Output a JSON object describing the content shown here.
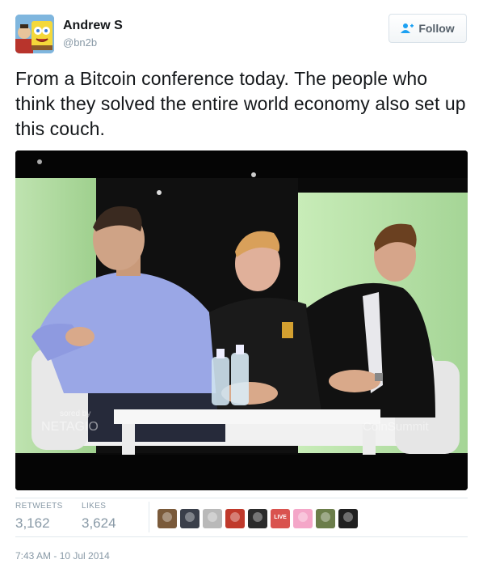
{
  "author": {
    "name": "Andrew S",
    "handle": "@bn2b",
    "avatar": "avatar-sponge-cartoon"
  },
  "follow_button": {
    "label": "Follow",
    "icon": "follow-user-plus-icon"
  },
  "tweet": {
    "text": "From a Bitcoin conference today. The people who think they solved the entire world economy also set up this couch."
  },
  "photo": {
    "description_icon": "conference-panel-photo",
    "sponsor_text": "sored by",
    "sponsor_brand": "NETAGIO",
    "watermark": "CoinSummit"
  },
  "stats": {
    "retweets_label": "RETWEETS",
    "retweets_value": "3,162",
    "likes_label": "LIKES",
    "likes_value": "3,624"
  },
  "likers": [
    {
      "name": "liker-avatar-1",
      "color": "#7a5a3a"
    },
    {
      "name": "liker-avatar-2",
      "color": "#3a3f4a"
    },
    {
      "name": "liker-avatar-3",
      "color": "#b9b9b9"
    },
    {
      "name": "liker-avatar-4",
      "color": "#c0392b"
    },
    {
      "name": "liker-avatar-5",
      "color": "#2b2b2b"
    },
    {
      "name": "liker-avatar-6",
      "color": "#d9534f",
      "text": "LIVE"
    },
    {
      "name": "liker-avatar-7",
      "color": "#f4a6c8"
    },
    {
      "name": "liker-avatar-8",
      "color": "#6b7d4a"
    },
    {
      "name": "liker-avatar-9",
      "color": "#1f1f1f"
    }
  ],
  "timestamp": "7:43 AM - 10 Jul 2014",
  "colors": {
    "text_primary": "#14171a",
    "text_muted": "#8899a6",
    "border": "#e1e8ed"
  }
}
